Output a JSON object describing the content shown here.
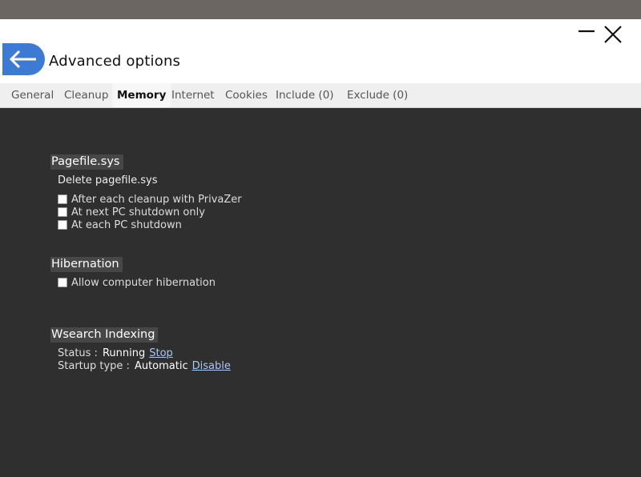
{
  "window": {
    "title": "Advanced options"
  },
  "tabs": [
    {
      "label": "General"
    },
    {
      "label": "Cleanup"
    },
    {
      "label": "Memory"
    },
    {
      "label": "Internet"
    },
    {
      "label": "Cookies"
    },
    {
      "label": "Include (0)"
    },
    {
      "label": "Exclude (0)"
    }
  ],
  "active_tab": "Memory",
  "pagefile": {
    "heading": "Pagefile.sys",
    "subheading": "Delete pagefile.sys",
    "options": [
      {
        "label": "After each cleanup with PrivaZer",
        "checked": false
      },
      {
        "label": "At next PC shutdown only",
        "checked": false
      },
      {
        "label": "At each PC shutdown",
        "checked": false
      }
    ]
  },
  "hibernation": {
    "heading": "Hibernation",
    "options": [
      {
        "label": "Allow computer hibernation",
        "checked": false
      }
    ]
  },
  "wsearch": {
    "heading": "Wsearch Indexing",
    "status_label": "Status :",
    "status_value": "Running",
    "status_action": "Stop",
    "startup_label": "Startup type :",
    "startup_value": "Automatic",
    "startup_action": "Disable"
  },
  "colors": {
    "accent": "#3d7ad4",
    "content_bg": "#2f2f2f",
    "link": "#a9c9ee"
  }
}
